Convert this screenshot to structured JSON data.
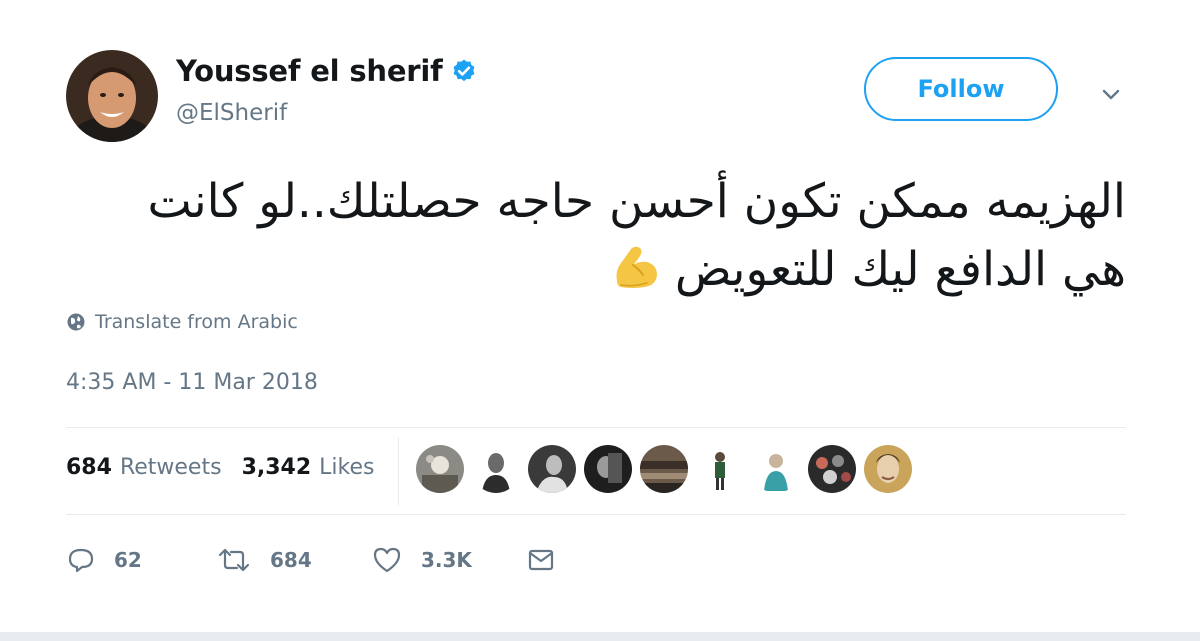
{
  "author": {
    "display_name": "Youssef el sherif",
    "handle": "@ElSherif",
    "verified": true
  },
  "follow_label": "Follow",
  "tweet": {
    "lines": [
      "الهزيمه ممكن تكون أحسن حاجه حصلتلك..لو كانت",
      "هي الدافع ليك للتعويض"
    ],
    "emoji": "flexed-biceps"
  },
  "translate_label": "Translate from Arabic",
  "timestamp": "4:35 AM - 11 Mar 2018",
  "stats": {
    "retweets_count": "684",
    "retweets_label": "Retweets",
    "likes_count": "3,342",
    "likes_label": "Likes"
  },
  "likers_count_shown": 9,
  "actions": {
    "reply_count": "62",
    "retweet_count": "684",
    "like_count": "3.3K"
  },
  "colors": {
    "accent": "#1da1f2",
    "muted_text": "#657786",
    "primary_text": "#14171a",
    "divider": "#e6ecf0"
  },
  "icons": [
    "verified-badge-icon",
    "chevron-down-icon",
    "globe-icon",
    "reply-icon",
    "retweet-icon",
    "heart-icon",
    "envelope-icon",
    "flexed-biceps-emoji"
  ]
}
